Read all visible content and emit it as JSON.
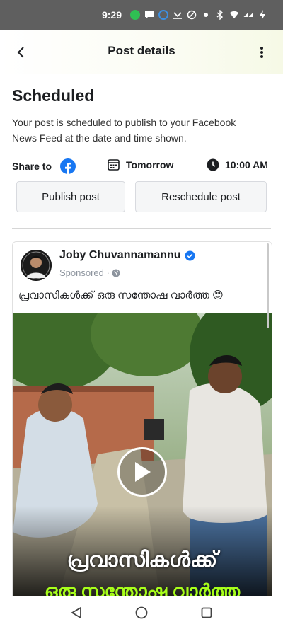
{
  "status_bar": {
    "time": "9:29"
  },
  "header": {
    "title": "Post details"
  },
  "schedule": {
    "title": "Scheduled",
    "description": "Your post is scheduled to publish to your Facebook News Feed at the date and time shown.",
    "share_label": "Share to",
    "date": "Tomorrow",
    "time": "10:00 AM",
    "publish_button": "Publish post",
    "reschedule_button": "Reschedule post"
  },
  "post": {
    "author": "Joby Chuvannamannu",
    "sponsored": "Sponsored ·",
    "caption": "പ്രവാസികൾക്ക് ഒരു സന്തോഷ വാർത്ത 😍",
    "overlay_line1": "പ്രവാസികൾക്ക്",
    "overlay_line2": "ഒരു സന്തോഷ വാർത്ത"
  },
  "colors": {
    "facebook_blue": "#1877f2",
    "overlay_green": "#a7ff1a",
    "status_bar_bg": "#5f5f5f"
  },
  "icons": [
    "whatsapp-icon",
    "chat-icon",
    "circle-icon",
    "missed-call-icon",
    "blocked-icon",
    "dot-icon",
    "bluetooth-icon",
    "wifi-icon",
    "signal-icon",
    "battery-icon",
    "back-arrow-icon",
    "more-vertical-icon",
    "facebook-icon",
    "calendar-icon",
    "clock-icon",
    "verified-icon",
    "globe-icon",
    "play-icon",
    "nav-back-icon",
    "nav-home-icon",
    "nav-recents-icon"
  ]
}
